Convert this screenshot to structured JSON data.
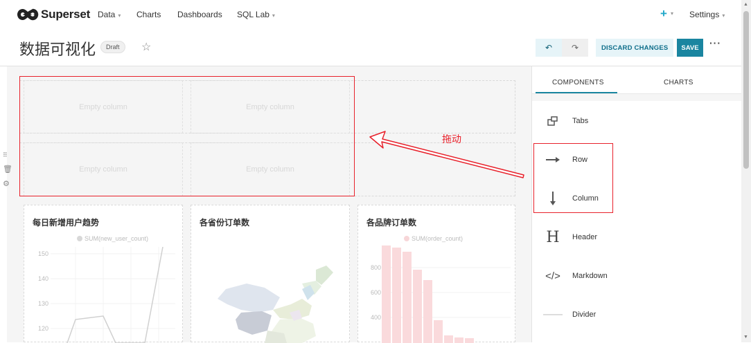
{
  "navbar": {
    "brand": "Superset",
    "items": [
      "Data",
      "Charts",
      "Dashboards",
      "SQL Lab"
    ],
    "plus": "+",
    "settings": "Settings"
  },
  "header": {
    "title": "数据可视化",
    "badge": "Draft",
    "discard_label": "DISCARD CHANGES",
    "save_label": "SAVE",
    "more": "···"
  },
  "canvas": {
    "empty_column_label": "Empty column",
    "drag_annotation": "拖动"
  },
  "charts": [
    {
      "title": "每日新增用户趋势",
      "legend": "SUM(new_user_count)",
      "yticks": [
        "150",
        "140",
        "130",
        "120"
      ]
    },
    {
      "title": "各省份订单数"
    },
    {
      "title": "各品牌订单数",
      "legend": "SUM(order_count)",
      "yticks": [
        "800",
        "600",
        "400"
      ]
    }
  ],
  "panel": {
    "tabs": [
      "COMPONENTS",
      "CHARTS"
    ],
    "components": [
      "Tabs",
      "Row",
      "Column",
      "Header",
      "Markdown",
      "Divider"
    ]
  },
  "colors": {
    "accent": "#1a85a0",
    "annotation": "#e8202a"
  }
}
